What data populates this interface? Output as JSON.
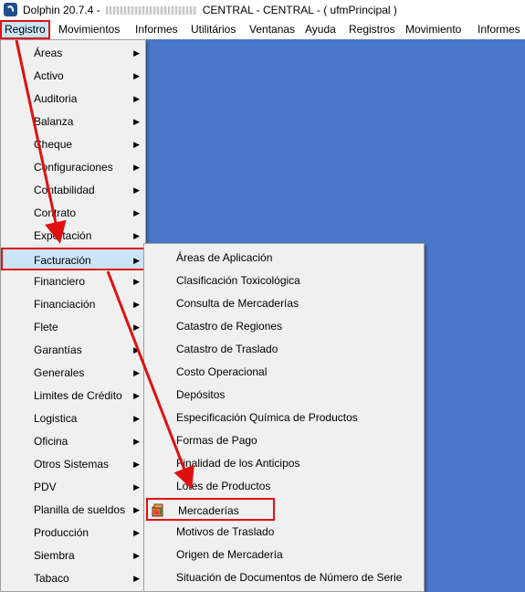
{
  "window": {
    "title_prefix": "Dolphin 20.7.4 -",
    "title_suffix": "CENTRAL - CENTRAL -  ( ufmPrincipal )"
  },
  "menubar": [
    "Registro",
    "Movimientos",
    "Informes",
    "Utilitários",
    "Ventanas",
    "Ayuda",
    "Registros",
    "Movimiento",
    "Informes"
  ],
  "registro_menu": [
    "Áreas",
    "Activo",
    "Auditoria",
    "Balanza",
    "Cheque",
    "Configuraciones",
    "Contabilidad",
    "Contrato",
    "Exportación",
    "Facturación",
    "Financiero",
    "Financiación",
    "Flete",
    "Garantías",
    "Generales",
    "Limites de Crédito",
    "Logistica",
    "Oficina",
    "Otros Sistemas",
    "PDV",
    "Planilla de sueldos",
    "Producción",
    "Siembra",
    "Tabaco"
  ],
  "facturacion_menu": [
    "Áreas de Aplicación",
    "Clasificación Toxicológica",
    "Consulta de Mercaderías",
    "Catastro de Regiones",
    "Catastro de Traslado",
    "Costo Operacional",
    "Depósitos",
    "Especificación Química de Productos",
    "Formas de Pago",
    "Finalidad de los Anticipos",
    "Lotes de Productos",
    "Mercaderías",
    "Motivos de Traslado",
    "Origen de Mercadería",
    "Situación de Documentos de Número de Serie"
  ],
  "colors": {
    "desktop": "#4a78c8",
    "highlight_border": "#e01010",
    "highlight_fill": "#cce4f7"
  }
}
